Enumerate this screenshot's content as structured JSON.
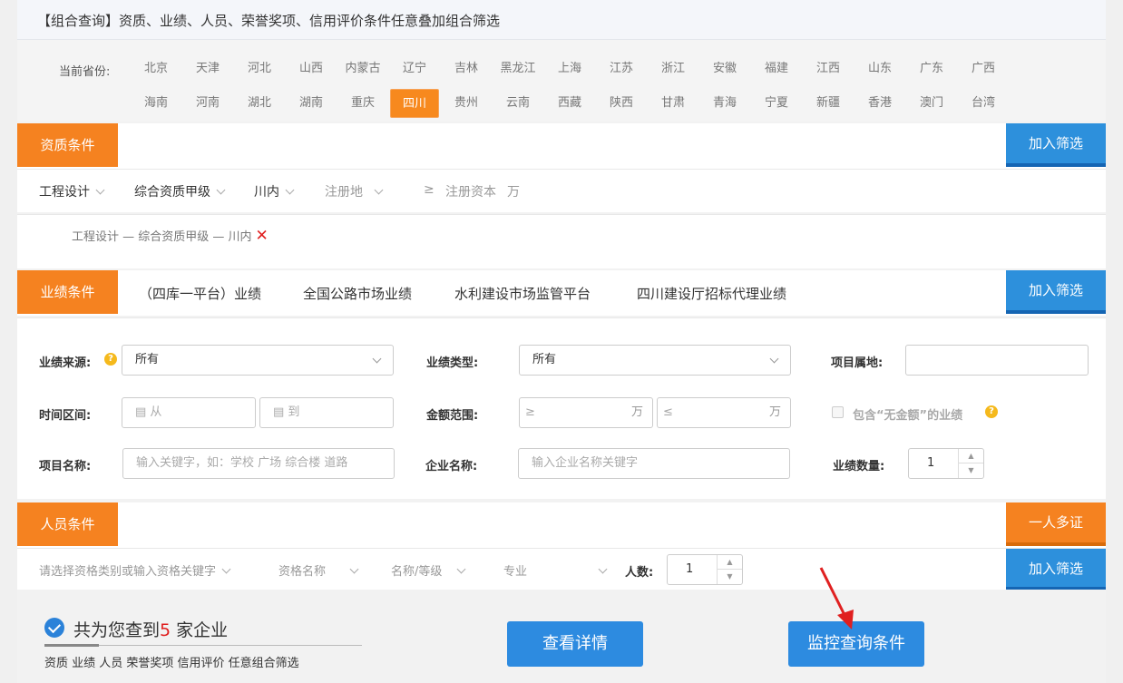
{
  "header": {
    "title": "【组合查询】资质、业绩、人员、荣誉奖项、信用评价条件任意叠加组合筛选"
  },
  "provinces": {
    "label": "当前省份:",
    "row1": [
      "北京",
      "天津",
      "河北",
      "山西",
      "内蒙古",
      "辽宁",
      "吉林",
      "黑龙江",
      "上海",
      "江苏",
      "浙江",
      "安徽",
      "福建",
      "江西",
      "山东",
      "广东",
      "广西"
    ],
    "row2": [
      "海南",
      "河南",
      "湖北",
      "湖南",
      "重庆",
      "四川",
      "贵州",
      "云南",
      "西藏",
      "陕西",
      "甘肃",
      "青海",
      "宁夏",
      "新疆",
      "香港",
      "澳门",
      "台湾"
    ],
    "active": "四川"
  },
  "qualification": {
    "tag": "资质条件",
    "add_label": "加入筛选",
    "filters": {
      "category": "工程设计",
      "level": "综合资质甲级",
      "region": "川内",
      "reg_place": "注册地",
      "capital_ge": "≥",
      "capital_label": "注册资本",
      "capital_unit": "万"
    },
    "chosen": "工程设计 — 综合资质甲级 — 川内",
    "remove_icon": "✕"
  },
  "performance": {
    "tag": "业绩条件",
    "add_label": "加入筛选",
    "tabs": [
      "（四库一平台）业绩",
      "全国公路市场业绩",
      "水利建设市场监管平台",
      "四川建设厅招标代理业绩"
    ],
    "source_label": "业绩来源:",
    "source_value": "所有",
    "type_label": "业绩类型:",
    "type_value": "所有",
    "location_label": "项目属地:",
    "location_value": "",
    "time_label": "时间区间:",
    "time_from": "从",
    "time_to": "到",
    "amount_label": "金额范围:",
    "amount_ge": "≥",
    "amount_le": "≤",
    "amount_unit": "万",
    "include_label": "包含“无金额”的业绩",
    "project_label": "项目名称:",
    "project_placeholder": "输入关键字，如：学校 广场 综合楼 道路",
    "company_label": "企业名称:",
    "company_placeholder": "输入企业名称关键字",
    "count_label": "业绩数量:",
    "count_value": "1",
    "help_icon": "?"
  },
  "staff": {
    "tag": "人员条件",
    "multi_label": "一人多证",
    "add_label": "加入筛选",
    "cert_placeholder": "请选择资格类别或输入资格关键字",
    "cert_name": "资格名称",
    "cert_level": "名称/等级",
    "major": "专业",
    "count_label": "人数:",
    "count_value": "1"
  },
  "result": {
    "prefix": "共为您查到",
    "count": "5",
    "suffix": " 家企业",
    "sub": "资质 业绩 人员 荣誉奖项 信用评价 任意组合筛选",
    "detail_btn": "查看详情",
    "monitor_btn": "监控查询条件"
  },
  "colors": {
    "orange": "#f58220",
    "blue": "#2d8be0",
    "red": "#e02020"
  }
}
